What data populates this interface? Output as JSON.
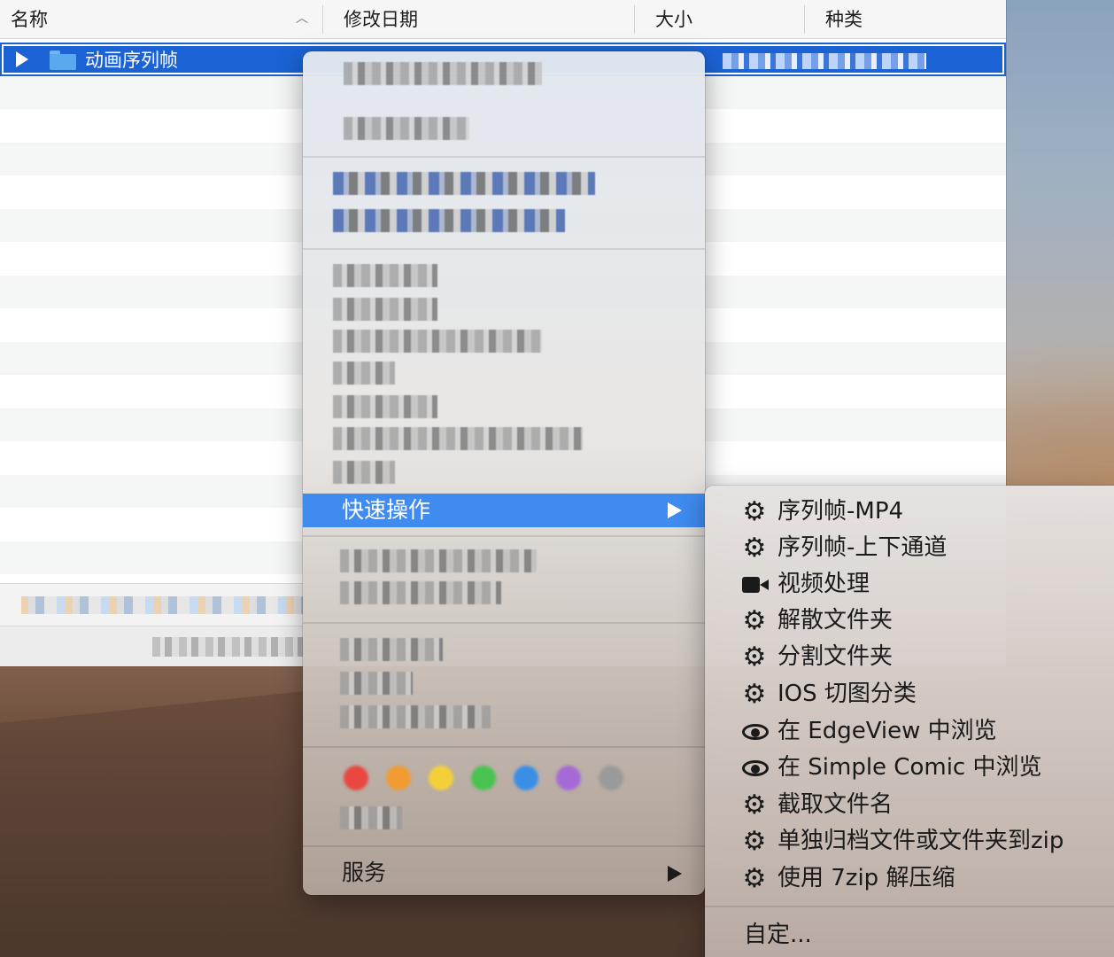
{
  "finder": {
    "columns": [
      "名称",
      "修改日期",
      "大小",
      "种类"
    ],
    "selected_row": {
      "name": "动画序列帧"
    }
  },
  "context_menu": {
    "quick_actions_label": "快速操作",
    "services_label": "服务",
    "tag_colors": [
      "#e8483f",
      "#f29b32",
      "#f5cf3a",
      "#49c34f",
      "#3a8ee6",
      "#a56ad6",
      "#9a9a9a"
    ]
  },
  "quick_actions_submenu": {
    "items": [
      {
        "icon": "gear-icon",
        "label": "序列帧-MP4"
      },
      {
        "icon": "gear-icon",
        "label": "序列帧-上下通道"
      },
      {
        "icon": "video-camera-icon",
        "label": "视频处理"
      },
      {
        "icon": "gear-icon",
        "label": "解散文件夹"
      },
      {
        "icon": "gear-icon",
        "label": "分割文件夹"
      },
      {
        "icon": "gear-icon",
        "label": "IOS 切图分类"
      },
      {
        "icon": "eye-icon",
        "label": "在 EdgeView 中浏览"
      },
      {
        "icon": "eye-icon",
        "label": "在 Simple Comic 中浏览"
      },
      {
        "icon": "gear-icon",
        "label": "截取文件名"
      },
      {
        "icon": "gear-icon",
        "label": "单独归档文件或文件夹到zip"
      },
      {
        "icon": "gear-icon",
        "label": "使用 7zip 解压缩"
      }
    ],
    "customize_label": "自定..."
  }
}
